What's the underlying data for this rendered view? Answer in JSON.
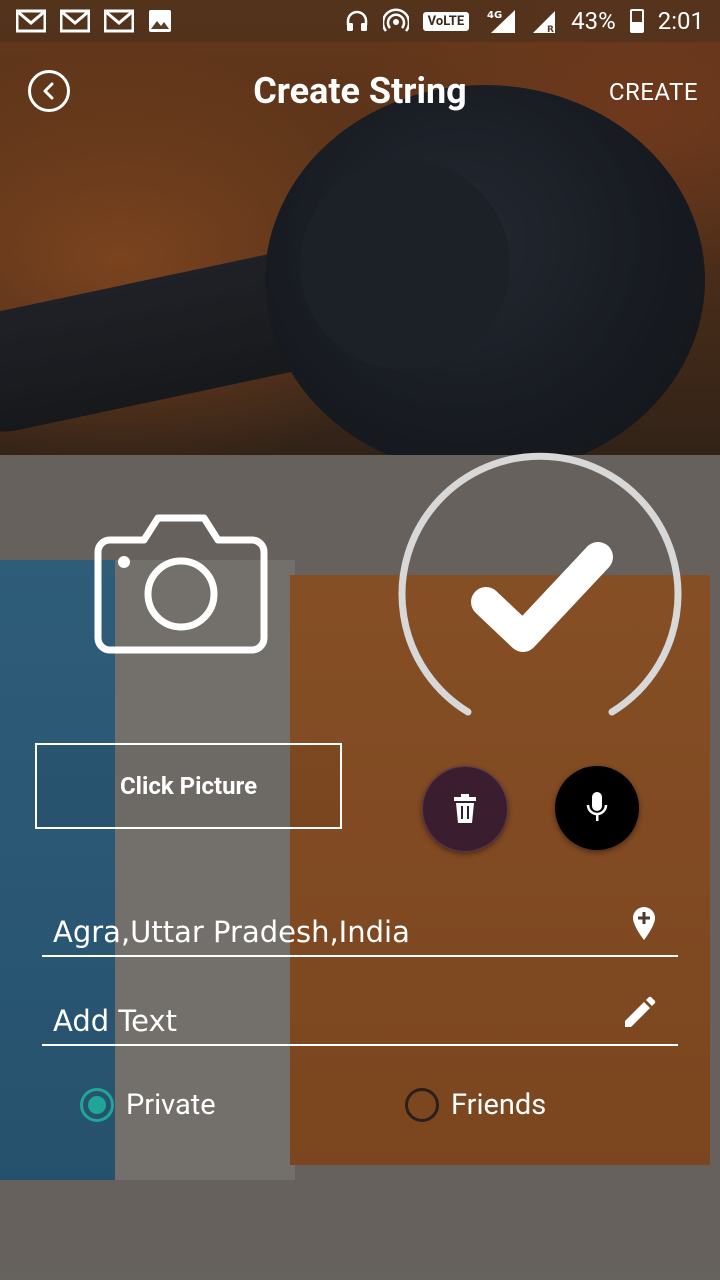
{
  "status_bar": {
    "network": "4G",
    "volte": "VoLTE",
    "battery": "43%",
    "time": "2:01",
    "left_icons": [
      "gmail-icon",
      "gmail-icon",
      "gmail-icon",
      "image-icon"
    ],
    "right_icons": [
      "headset-icon",
      "hotspot-icon",
      "volte-icon",
      "signal-icon",
      "signal-r-icon",
      "battery-icon"
    ]
  },
  "app_bar": {
    "title": "Create String",
    "action": "CREATE"
  },
  "media": {
    "click_picture_label": "Click Picture"
  },
  "location": {
    "value": "Agra,Uttar Pradesh,India"
  },
  "text_input": {
    "placeholder": "Add Text"
  },
  "visibility": {
    "options": [
      "Private",
      "Friends"
    ],
    "selected": "Private"
  },
  "colors": {
    "accent": "#1ea698",
    "trash_button": "#3a1e30",
    "mic_button": "#000000"
  }
}
